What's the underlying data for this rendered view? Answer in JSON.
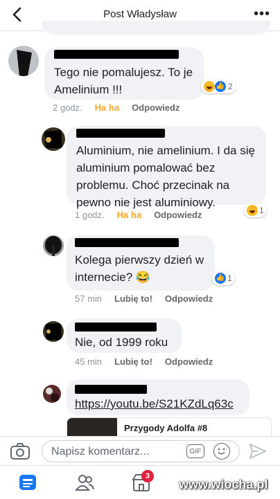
{
  "header": {
    "title": "Post Władysław",
    "more_label": "•••"
  },
  "comments": [
    {
      "text_lines": [
        "Tego nie pomalujesz. To je",
        "Amelinium !!!"
      ],
      "time": "2 godz.",
      "reaction_label": "Ha ha",
      "reply_label": "Odpowiedz",
      "reaction_count": "2"
    },
    {
      "text_lines": [
        "Aluminium, nie amelinium. I da się",
        "aluminium pomalować bez",
        "problemu. Choć przecinak na",
        "pewno nie jest aluminiowy."
      ],
      "time": "1 godz.",
      "reaction_label": "Ha ha",
      "reply_label": "Odpowiedz",
      "reaction_count": "1"
    },
    {
      "text_lines": [
        "Kolega pierwszy dzień w",
        "internecie? 😂"
      ],
      "time": "57 min",
      "like_label": "Lubię to!",
      "reply_label": "Odpowiedz",
      "reaction_count": "1"
    },
    {
      "text_lines": [
        "Nie, od 1999 roku"
      ],
      "time": "45 min",
      "like_label": "Lubię to!",
      "reply_label": "Odpowiedz"
    },
    {
      "link": "https://youtu.be/S21KZdLq63c",
      "preview_title": "Przygody Adolfa #8"
    }
  ],
  "composer": {
    "placeholder": "Napisz komentarz...",
    "gif_label": "GIF"
  },
  "tabbar": {
    "badge": "3"
  },
  "watermark": "www.wiocha.pl"
}
